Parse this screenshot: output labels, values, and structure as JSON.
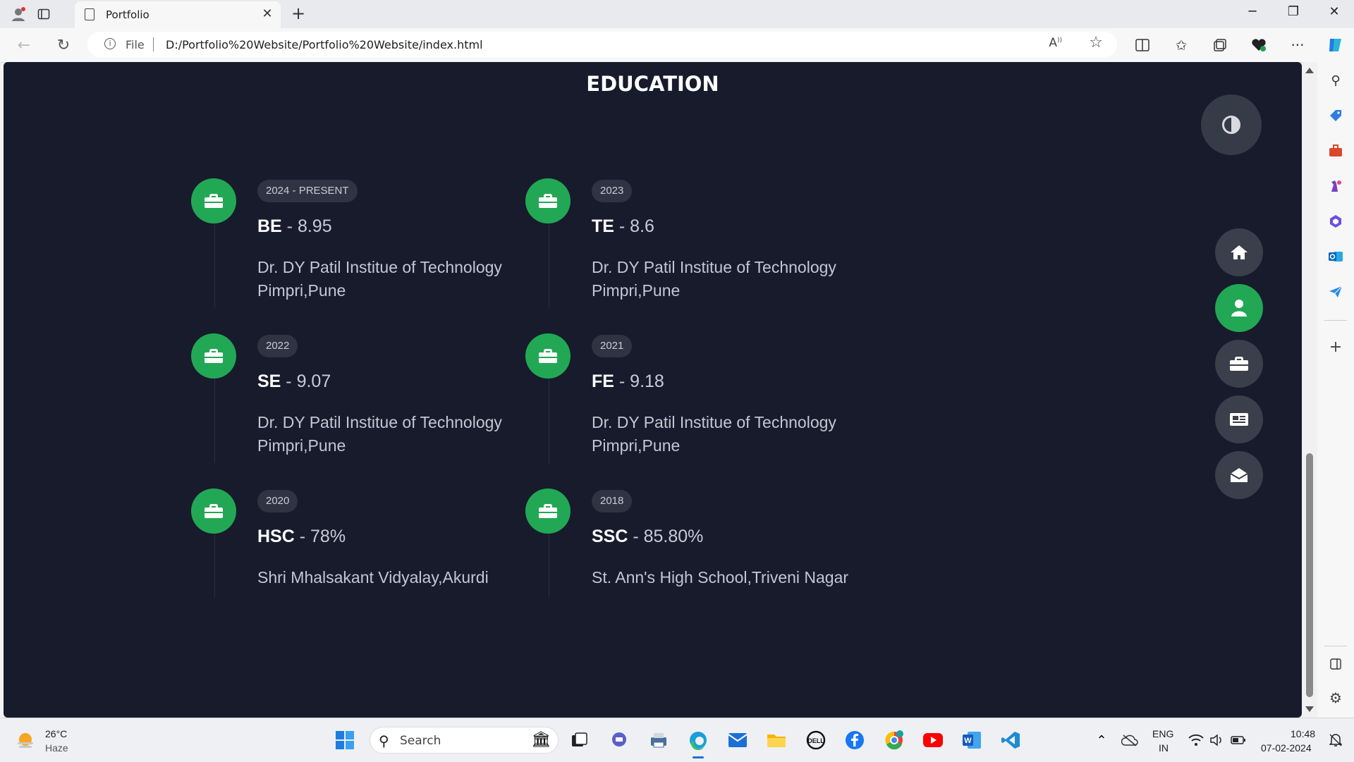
{
  "browser": {
    "tab_title": "Portfolio",
    "address_prefix": "File",
    "url": "D:/Portfolio%20Website/Portfolio%20Website/index.html"
  },
  "page": {
    "heading": "EDUCATION",
    "timeline": [
      {
        "date": "2024 - PRESENT",
        "degree": "BE",
        "score": "8.95",
        "institute": "Dr. DY Patil Institue of Technology",
        "location": "Pimpri,Pune"
      },
      {
        "date": "2023",
        "degree": "TE",
        "score": "8.6",
        "institute": "Dr. DY Patil Institue of Technology",
        "location": "Pimpri,Pune"
      },
      {
        "date": "2022",
        "degree": "SE",
        "score": "9.07",
        "institute": "Dr. DY Patil Institue of Technology",
        "location": "Pimpri,Pune"
      },
      {
        "date": "2021",
        "degree": "FE",
        "score": "9.18",
        "institute": "Dr. DY Patil Institue of Technology",
        "location": "Pimpri,Pune"
      },
      {
        "date": "2020",
        "degree": "HSC",
        "score": "78%",
        "institute": "Shri Mhalsakant Vidyalay,Akurdi",
        "location": ""
      },
      {
        "date": "2018",
        "degree": "SSC",
        "score": "85.80%",
        "institute": "St. Ann's High School,Triveni Nagar",
        "location": ""
      }
    ],
    "side_nav": [
      "home-icon",
      "user-icon",
      "briefcase-icon",
      "newspaper-icon",
      "envelope-open-icon"
    ],
    "accent_color": "#22a854",
    "background_color": "#171b2c"
  },
  "taskbar": {
    "weather_temp": "26°C",
    "weather_desc": "Haze",
    "search_placeholder": "Search",
    "lang_line1": "ENG",
    "lang_line2": "IN",
    "time": "10:48",
    "date": "07-02-2024"
  }
}
